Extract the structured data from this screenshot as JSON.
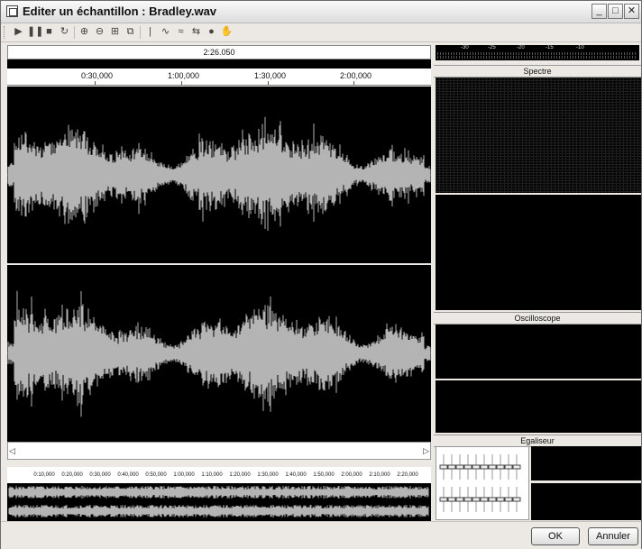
{
  "window": {
    "title": "Editer un échantillon : Bradley.wav",
    "minimize_icon": "minimize-icon",
    "maximize_icon": "maximize-icon",
    "close_icon": "close-icon"
  },
  "toolbar": {
    "buttons": [
      {
        "name": "play-icon",
        "glyph": "▶"
      },
      {
        "name": "pause-icon",
        "glyph": "❚❚"
      },
      {
        "name": "stop-icon",
        "glyph": "■"
      },
      {
        "name": "loop-icon",
        "glyph": "↻"
      },
      {
        "name": "zoom-in-icon",
        "glyph": "⊕"
      },
      {
        "name": "zoom-out-icon",
        "glyph": "⊖"
      },
      {
        "name": "select-icon",
        "glyph": "⊞"
      },
      {
        "name": "crop-icon",
        "glyph": "⧉"
      },
      {
        "name": "marker-icon",
        "glyph": "|"
      },
      {
        "name": "normalize-icon",
        "glyph": "∿"
      },
      {
        "name": "fade-icon",
        "glyph": "≈"
      },
      {
        "name": "reverse-icon",
        "glyph": "⇆"
      },
      {
        "name": "record-icon",
        "glyph": "●"
      },
      {
        "name": "hand-icon",
        "glyph": "✋"
      }
    ]
  },
  "editor": {
    "selection_time": "2:26.050",
    "ruler_labels": [
      "0:30,000",
      "1:00,000",
      "1:30,000",
      "2:00,000"
    ],
    "overview_labels": [
      "0:10,000",
      "0:20,000",
      "0:30,000",
      "0:40,000",
      "0:50,000",
      "1:00,000",
      "1:10,000",
      "1:20,000",
      "1:30,000",
      "1:40,000",
      "1:50,000",
      "2:00,000",
      "2:10,000",
      "2:20,000"
    ]
  },
  "panels": {
    "vu_labels": [
      "-30",
      "-25",
      "-20",
      "-15",
      "-10"
    ],
    "spectrum_title": "Spectre",
    "oscilloscope_title": "Oscilloscope",
    "equalizer_title": "Egaliseur"
  },
  "buttons": {
    "ok_label": "OK",
    "cancel_label": "Annuler"
  },
  "colors": {
    "waveform": "#b4b4b4",
    "background": "#000000"
  }
}
